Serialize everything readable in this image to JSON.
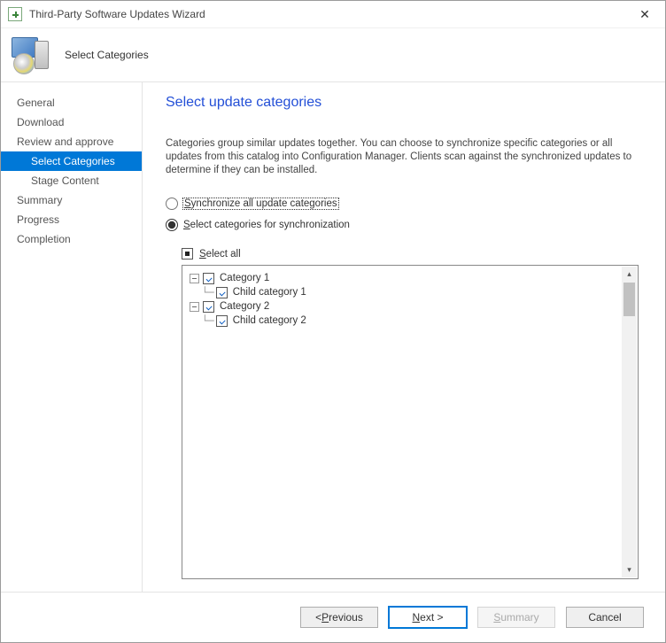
{
  "window": {
    "title": "Third-Party Software Updates Wizard"
  },
  "header": {
    "step_title": "Select Categories"
  },
  "sidebar": {
    "items": [
      {
        "label": "General",
        "indent": 0,
        "selected": false
      },
      {
        "label": "Download",
        "indent": 0,
        "selected": false
      },
      {
        "label": "Review and approve",
        "indent": 0,
        "selected": false
      },
      {
        "label": "Select Categories",
        "indent": 1,
        "selected": true
      },
      {
        "label": "Stage Content",
        "indent": 1,
        "selected": false
      },
      {
        "label": "Summary",
        "indent": 0,
        "selected": false
      },
      {
        "label": "Progress",
        "indent": 0,
        "selected": false
      },
      {
        "label": "Completion",
        "indent": 0,
        "selected": false
      }
    ]
  },
  "page": {
    "heading": "Select update categories",
    "description": "Categories group similar updates together. You can choose to synchronize specific categories or all updates from this catalog into Configuration Manager. Clients scan against the synchronized updates to determine if they can be installed.",
    "radio_all": {
      "prefix": "S",
      "rest": "ynchronize all update categories",
      "checked": false
    },
    "radio_select": {
      "prefix": "S",
      "rest": "elect categories for synchronization",
      "checked": true
    },
    "select_all": {
      "prefix": "S",
      "rest": "elect all",
      "state": "indeterminate"
    },
    "tree": [
      {
        "label": "Category 1",
        "level": 0,
        "checked": true,
        "expandable": true
      },
      {
        "label": "Child category 1",
        "level": 1,
        "checked": true,
        "expandable": false
      },
      {
        "label": "Category 2",
        "level": 0,
        "checked": true,
        "expandable": true
      },
      {
        "label": "Child category 2",
        "level": 1,
        "checked": true,
        "expandable": false
      }
    ]
  },
  "footer": {
    "previous_prefix": "< ",
    "previous_ak": "P",
    "previous_rest": "revious",
    "next_ak": "N",
    "next_rest": "ext >",
    "summary_ak": "S",
    "summary_rest": "ummary",
    "cancel": "Cancel"
  }
}
